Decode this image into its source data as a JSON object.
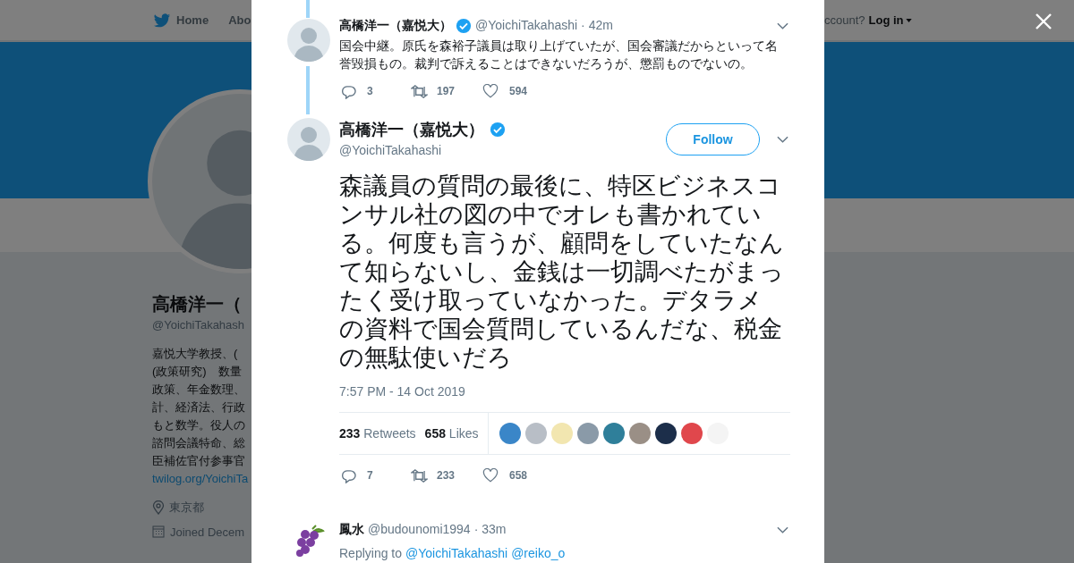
{
  "background_page": {
    "nav": {
      "items": [
        "Home",
        "Abo"
      ],
      "account_prompt": "ccount?",
      "login": "Log in"
    },
    "profile": {
      "name": "高橋洋一（",
      "handle": "@YoichiTakahash",
      "bio_lines": [
        "嘉悦大学教授、(",
        "(政策研究)　数量",
        "政策、年金数理、",
        "計、経済法、行政",
        "もと数学。役人の",
        "諮問会議特命、総",
        "臣補佐官付参事官"
      ],
      "link": "twilog.org/YoichiTa",
      "location": "東京都",
      "joined": "Joined Decem"
    }
  },
  "modal": {
    "parent_tweet": {
      "name": "高橋洋一（嘉悦大）",
      "verified": true,
      "handle": "@YoichiTakahashi",
      "time": "· 42m",
      "text": "国会中継。原氏を森裕子議員は取り上げていたが、国会審議だからといって名誉毀損もの。裁判で訴えることはできないだろうが、懲罰ものでないの。",
      "replies": "3",
      "retweets": "197",
      "likes": "594"
    },
    "main_tweet": {
      "name": "高橋洋一（嘉悦大）",
      "verified": true,
      "handle": "@YoichiTakahashi",
      "follow_button": "Follow",
      "text": "森議員の質問の最後に、特区ビジネスコンサル社の図の中でオレも書かれている。何度も言うが、顧問をしていたなんて知らないし、金銭は一切調べたがまったく受け取っていなかった。デタラメの資料で国会質問しているんだな、税金の無駄使いだろ",
      "timestamp": "7:57 PM - 14 Oct 2019",
      "retweet_count": "233",
      "retweet_label": "Retweets",
      "like_count": "658",
      "like_label": "Likes",
      "likers": [
        {
          "color": "#3a86c8"
        },
        {
          "color": "#b8bec6"
        },
        {
          "color": "#f2e6b0"
        },
        {
          "color": "#8a9aa8"
        },
        {
          "color": "#2f7f9a"
        },
        {
          "color": "#9a8f86"
        },
        {
          "color": "#1c2e4a"
        },
        {
          "color": "#e0474c"
        },
        {
          "color": "#f4f4f4"
        }
      ],
      "replies": "7",
      "retweets": "233",
      "likes": "658"
    },
    "reply": {
      "name": "鳳水",
      "handle": "@budounomi1994",
      "time": "· 33m",
      "replying_label": "Replying to",
      "mentions": [
        "@YoichiTakahashi",
        "@reiko_o"
      ]
    }
  }
}
